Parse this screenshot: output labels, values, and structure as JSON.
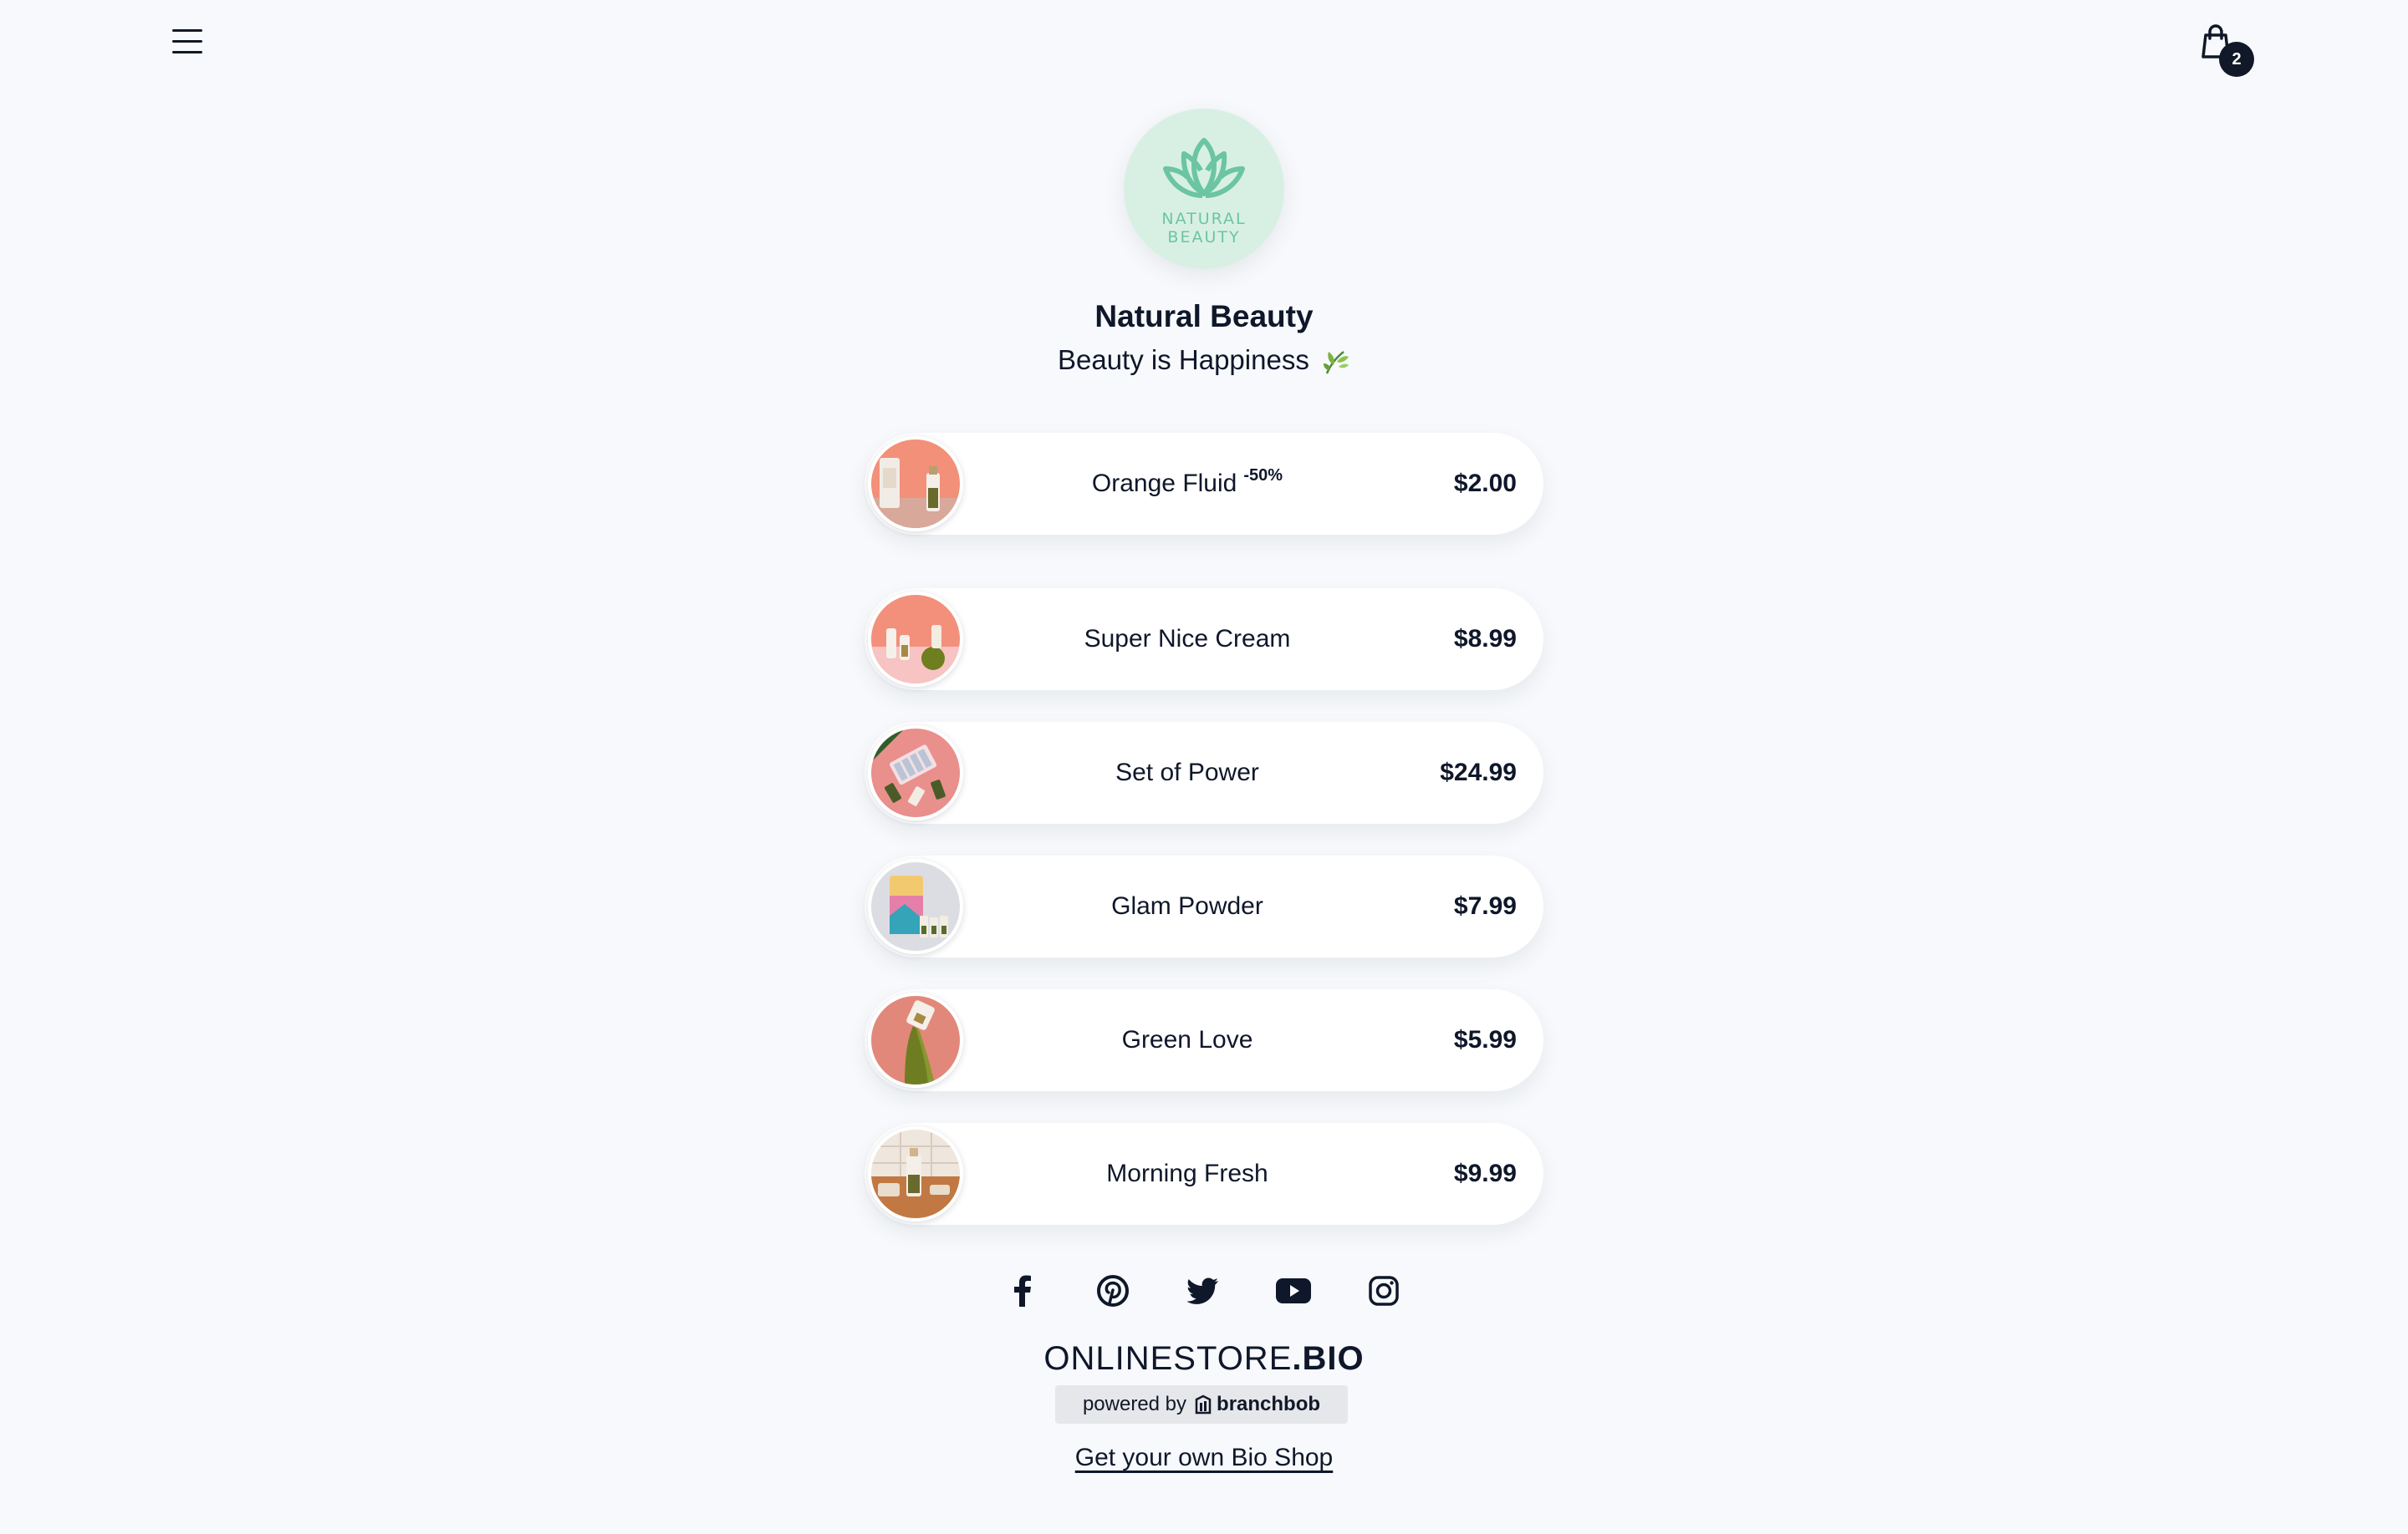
{
  "header": {
    "cart_count": "2",
    "logo_lines": [
      "NATURAL",
      "BEAUTY"
    ],
    "store_name": "Natural Beauty",
    "tagline": "Beauty is Happiness"
  },
  "products": [
    {
      "name": "Orange Fluid",
      "badge": "-50%",
      "price": "$2.00"
    },
    {
      "name": "Super Nice Cream",
      "badge": "",
      "price": "$8.99"
    },
    {
      "name": "Set of Power",
      "badge": "",
      "price": "$24.99"
    },
    {
      "name": "Glam Powder",
      "badge": "",
      "price": "$7.99"
    },
    {
      "name": "Green Love",
      "badge": "",
      "price": "$5.99"
    },
    {
      "name": "Morning Fresh",
      "badge": "",
      "price": "$9.99"
    }
  ],
  "socials": [
    "facebook-icon",
    "pinterest-icon",
    "twitter-icon",
    "youtube-icon",
    "instagram-icon"
  ],
  "footer": {
    "brand_light": "ONLINESTORE",
    "brand_bold": ".BIO",
    "powered_by": "powered by",
    "powered_brand": "branchbob",
    "cta": "Get your own Bio Shop"
  },
  "colors": {
    "background": "#f7f9fc",
    "logo_bg": "#d8f0e4",
    "logo_accent": "#6cc5a2",
    "text": "#0f172a"
  }
}
